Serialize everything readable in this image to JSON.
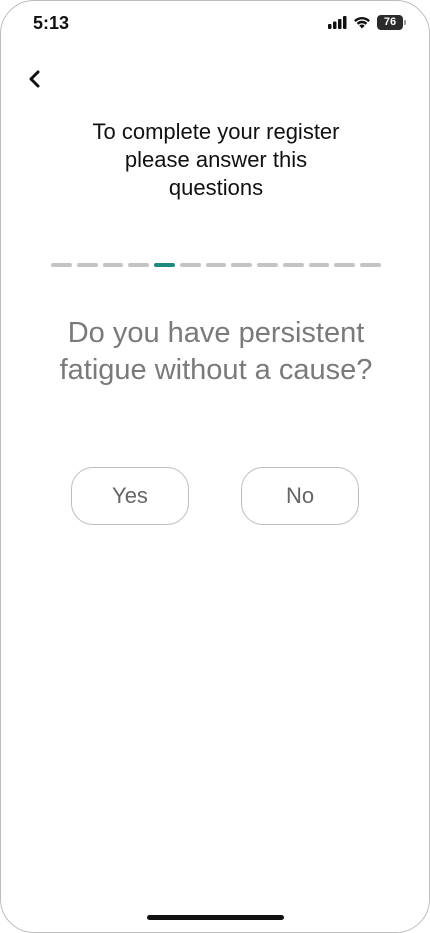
{
  "status_bar": {
    "time": "5:13",
    "battery_level": "76",
    "icons": [
      "signal-icon",
      "wifi-icon",
      "battery-icon"
    ]
  },
  "header": {
    "back_icon": "chevron-left-icon"
  },
  "main": {
    "title": "To complete your register\nplease answer this\n    questions",
    "progress": {
      "total_steps": 13,
      "current_step": 5,
      "active_color": "#1f8a7e",
      "inactive_color": "#c4c4c4"
    },
    "question": "Do you have persistent fatigue without a cause?",
    "answers": {
      "yes_label": "Yes",
      "no_label": "No"
    }
  }
}
